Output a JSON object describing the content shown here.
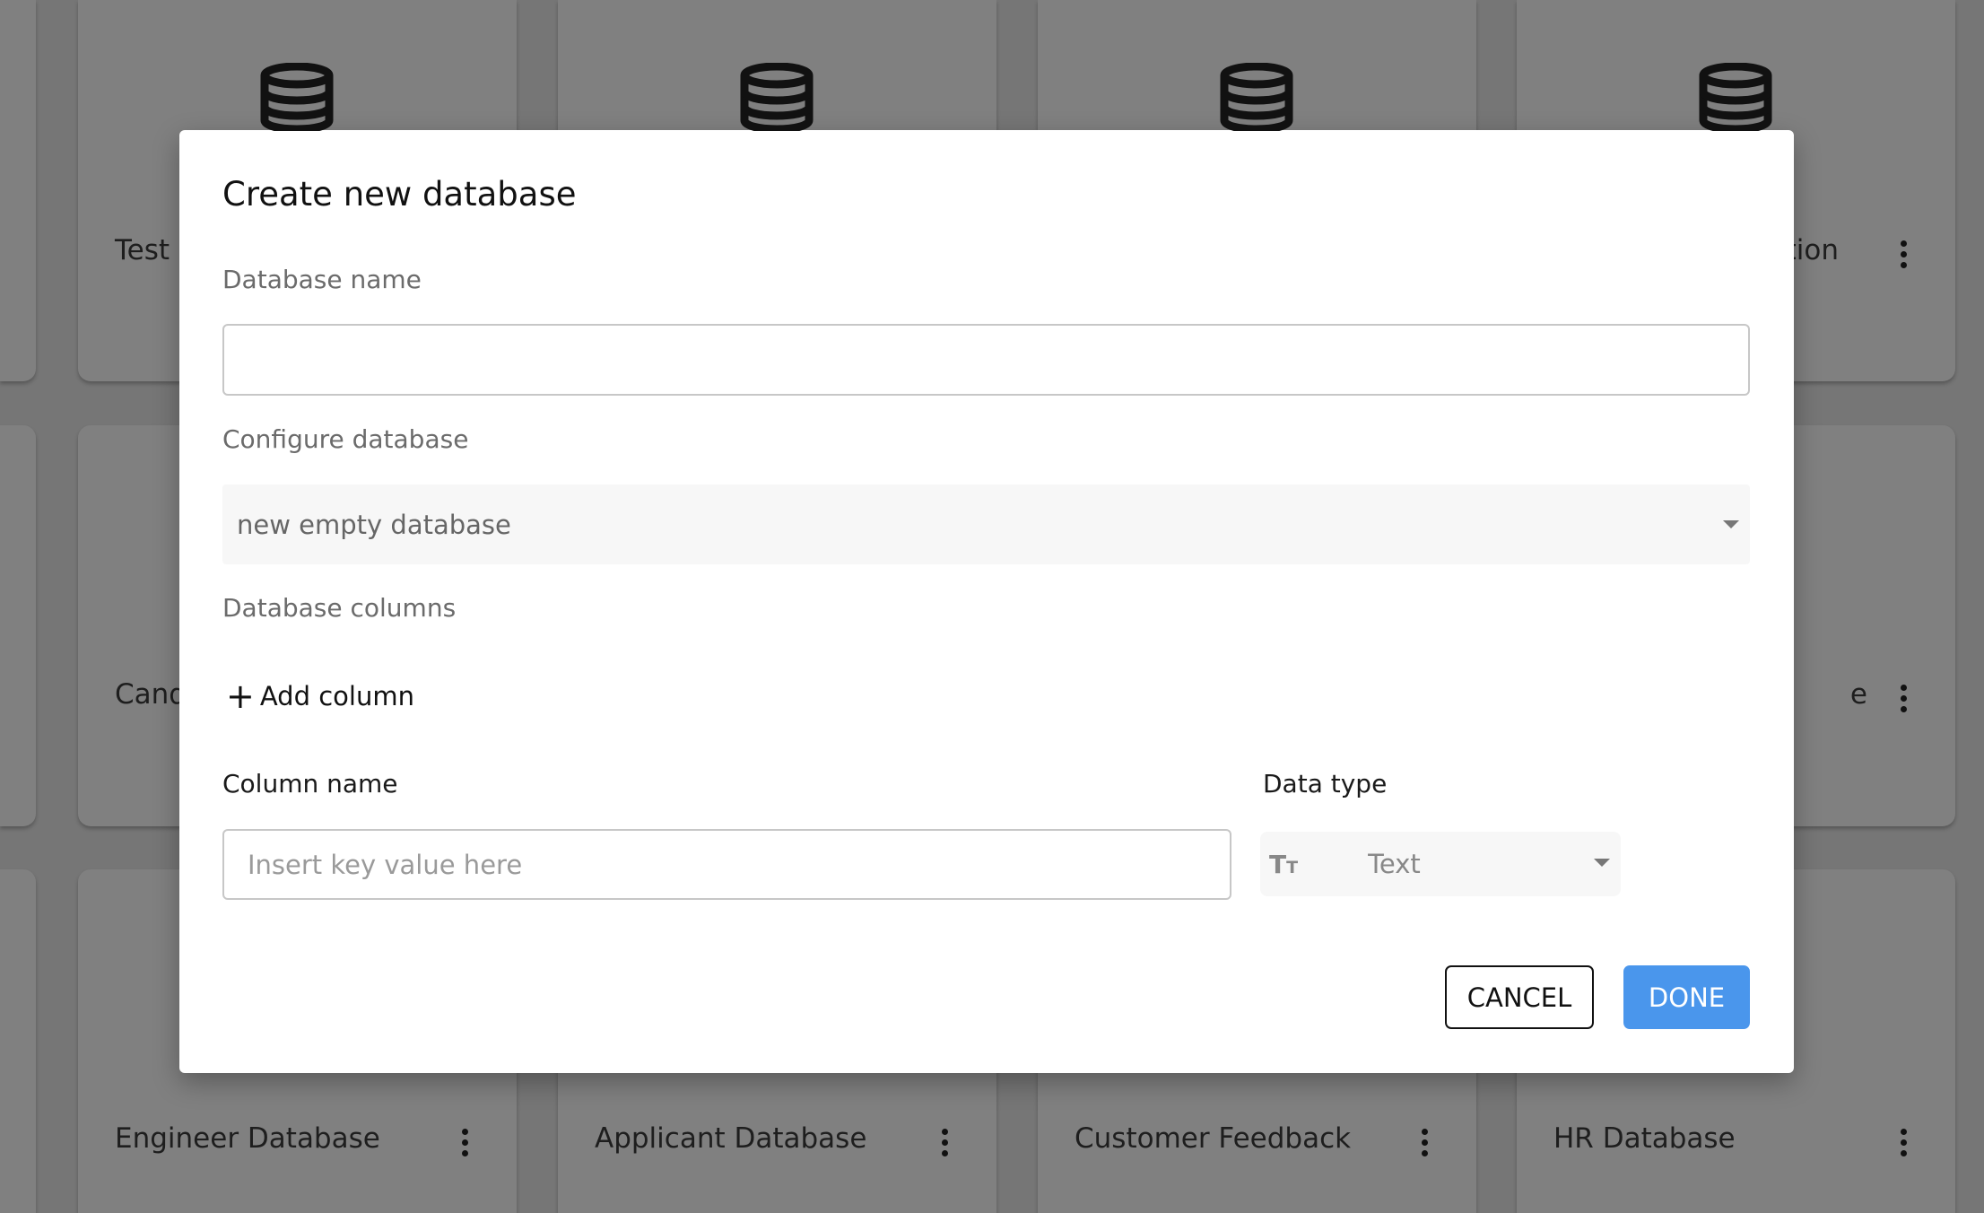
{
  "background_cards": {
    "row1": [
      {
        "title": "Test"
      },
      {
        "title": ""
      },
      {
        "title": ""
      },
      {
        "title": "tion"
      }
    ],
    "row2": [
      {
        "title": "Cand"
      },
      {
        "title": ""
      },
      {
        "title": ""
      },
      {
        "title": "e"
      }
    ],
    "row3": [
      {
        "title": "Engineer Database"
      },
      {
        "title": "Applicant Database"
      },
      {
        "title": "Customer Feedback"
      },
      {
        "title": "HR Database"
      }
    ],
    "icon": "database-icon"
  },
  "dialog": {
    "title": "Create new database",
    "db_name_label": "Database name",
    "db_name_value": "",
    "configure_label": "Configure database",
    "configure_value": "new empty database",
    "columns_label": "Database columns",
    "add_column": "Add column",
    "column_name_label": "Column name",
    "column_name_placeholder": "Insert key value here",
    "data_type_label": "Data type",
    "data_type_value": "Text",
    "data_type_icon": "text-fields-icon",
    "cancel": "CANCEL",
    "done": "DONE"
  },
  "colors": {
    "primary": "#4a96ec",
    "overlay": "#808080"
  }
}
